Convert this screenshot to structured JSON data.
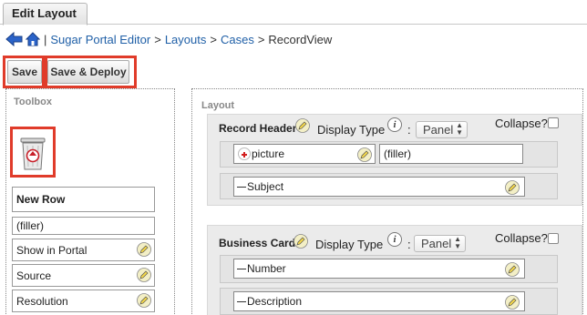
{
  "tab": {
    "label": "Edit Layout"
  },
  "breadcrumb": {
    "back_icon": "back-arrow-icon",
    "home_icon": "home-icon",
    "separator": "|",
    "items": [
      "Sugar Portal Editor",
      "Layouts",
      "Cases"
    ],
    "current": "RecordView",
    "arrow": ">"
  },
  "actions": {
    "save_label": "Save",
    "save_deploy_label": "Save & Deploy"
  },
  "toolbox": {
    "title": "Toolbox",
    "trash_icon": "recycle-bin-icon",
    "new_row": "New Row",
    "filler": "(filler)",
    "fields": [
      "Show in Portal",
      "Source",
      "Resolution"
    ]
  },
  "layout": {
    "title": "Layout",
    "display_type_label": "Display Type",
    "colon": ":",
    "collapse_label": "Collapse?",
    "sections": [
      {
        "title": "Record Header",
        "display_type": "Panel",
        "rows": [
          {
            "left": "picture",
            "right": "(filler)"
          },
          {
            "left": "Subject"
          }
        ]
      },
      {
        "title": "Business Card",
        "display_type": "Panel",
        "rows": [
          {
            "left": "Number"
          },
          {
            "left": "Description"
          }
        ]
      }
    ]
  },
  "colors": {
    "highlight": "#e03b2a",
    "link": "#1f5fa7"
  }
}
